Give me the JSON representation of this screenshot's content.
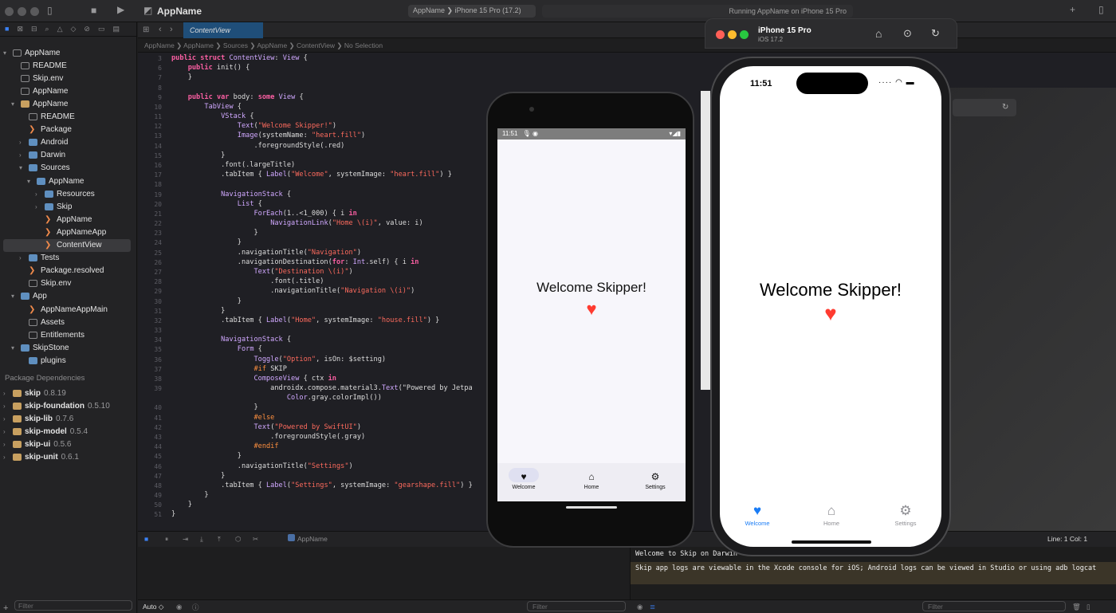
{
  "titlebar": {
    "app_name": "AppName",
    "scheme_target": "AppName  ❯  iPhone 15 Pro (17.2)",
    "status": "Running AppName on iPhone 15 Pro"
  },
  "editor": {
    "active_tab": "ContentView",
    "jumpbar": "AppName  ❯  AppName  ❯  Sources  ❯  AppName  ❯  ContentView  ❯  No Selection",
    "code_lines": [
      {
        "n": "3",
        "t": "public struct ContentView: View {"
      },
      {
        "n": "6",
        "t": "    public init() {"
      },
      {
        "n": "7",
        "t": "    }"
      },
      {
        "n": "8",
        "t": ""
      },
      {
        "n": "9",
        "t": "    public var body: some View {"
      },
      {
        "n": "10",
        "t": "        TabView {"
      },
      {
        "n": "11",
        "t": "            VStack {"
      },
      {
        "n": "12",
        "t": "                Text(\"Welcome Skipper!\")"
      },
      {
        "n": "13",
        "t": "                Image(systemName: \"heart.fill\")"
      },
      {
        "n": "14",
        "t": "                    .foregroundStyle(.red)"
      },
      {
        "n": "15",
        "t": "            }"
      },
      {
        "n": "16",
        "t": "            .font(.largeTitle)"
      },
      {
        "n": "17",
        "t": "            .tabItem { Label(\"Welcome\", systemImage: \"heart.fill\") }"
      },
      {
        "n": "18",
        "t": ""
      },
      {
        "n": "19",
        "t": "            NavigationStack {"
      },
      {
        "n": "20",
        "t": "                List {"
      },
      {
        "n": "21",
        "t": "                    ForEach(1..<1_000) { i in"
      },
      {
        "n": "22",
        "t": "                        NavigationLink(\"Home \\(i)\", value: i)"
      },
      {
        "n": "23",
        "t": "                    }"
      },
      {
        "n": "24",
        "t": "                }"
      },
      {
        "n": "25",
        "t": "                .navigationTitle(\"Navigation\")"
      },
      {
        "n": "26",
        "t": "                .navigationDestination(for: Int.self) { i in"
      },
      {
        "n": "27",
        "t": "                    Text(\"Destination \\(i)\")"
      },
      {
        "n": "28",
        "t": "                        .font(.title)"
      },
      {
        "n": "29",
        "t": "                        .navigationTitle(\"Navigation \\(i)\")"
      },
      {
        "n": "30",
        "t": "                }"
      },
      {
        "n": "31",
        "t": "            }"
      },
      {
        "n": "32",
        "t": "            .tabItem { Label(\"Home\", systemImage: \"house.fill\") }"
      },
      {
        "n": "33",
        "t": ""
      },
      {
        "n": "34",
        "t": "            NavigationStack {"
      },
      {
        "n": "35",
        "t": "                Form {"
      },
      {
        "n": "36",
        "t": "                    Toggle(\"Option\", isOn: $setting)"
      },
      {
        "n": "37",
        "t": "                    #if SKIP"
      },
      {
        "n": "38",
        "t": "                    ComposeView { ctx in"
      },
      {
        "n": "39",
        "t": "                        androidx.compose.material3.Text(\"Powered by Jetpa"
      },
      {
        "n": "",
        "t": "                            Color.gray.colorImpl())"
      },
      {
        "n": "40",
        "t": "                    }"
      },
      {
        "n": "41",
        "t": "                    #else"
      },
      {
        "n": "42",
        "t": "                    Text(\"Powered by SwiftUI\")"
      },
      {
        "n": "43",
        "t": "                        .foregroundStyle(.gray)"
      },
      {
        "n": "44",
        "t": "                    #endif"
      },
      {
        "n": "45",
        "t": "                }"
      },
      {
        "n": "46",
        "t": "                .navigationTitle(\"Settings\")"
      },
      {
        "n": "47",
        "t": "            }"
      },
      {
        "n": "48",
        "t": "            .tabItem { Label(\"Settings\", systemImage: \"gearshape.fill\") }"
      },
      {
        "n": "49",
        "t": "        }"
      },
      {
        "n": "50",
        "t": "    }"
      },
      {
        "n": "51",
        "t": "}"
      }
    ],
    "status_target": "AppName",
    "line_col": "Line: 1  Col: 1"
  },
  "navigator": {
    "items": [
      {
        "label": "AppName",
        "icon": "doc",
        "level": 0,
        "chev": "▾"
      },
      {
        "label": "README",
        "icon": "doc",
        "level": 1,
        "chev": ""
      },
      {
        "label": "Skip.env",
        "icon": "doc",
        "level": 1,
        "chev": ""
      },
      {
        "label": "AppName",
        "icon": "doc",
        "level": 1,
        "chev": ""
      },
      {
        "label": "AppName",
        "icon": "pkg",
        "level": 1,
        "chev": "▾"
      },
      {
        "label": "README",
        "icon": "doc",
        "level": 2,
        "chev": ""
      },
      {
        "label": "Package",
        "icon": "swift",
        "level": 2,
        "chev": ""
      },
      {
        "label": "Android",
        "icon": "folder",
        "level": 2,
        "chev": "›"
      },
      {
        "label": "Darwin",
        "icon": "folder",
        "level": 2,
        "chev": "›"
      },
      {
        "label": "Sources",
        "icon": "folder",
        "level": 2,
        "chev": "▾"
      },
      {
        "label": "AppName",
        "icon": "folder",
        "level": 3,
        "chev": "▾"
      },
      {
        "label": "Resources",
        "icon": "folder",
        "level": 4,
        "chev": "›"
      },
      {
        "label": "Skip",
        "icon": "folder",
        "level": 4,
        "chev": "›"
      },
      {
        "label": "AppName",
        "icon": "swift",
        "level": 4,
        "chev": ""
      },
      {
        "label": "AppNameApp",
        "icon": "swift",
        "level": 4,
        "chev": ""
      },
      {
        "label": "ContentView",
        "icon": "swift",
        "level": 4,
        "chev": "",
        "selected": true
      },
      {
        "label": "Tests",
        "icon": "folder",
        "level": 2,
        "chev": "›"
      },
      {
        "label": "Package.resolved",
        "icon": "swift",
        "level": 2,
        "chev": ""
      },
      {
        "label": "Skip.env",
        "icon": "doc",
        "level": 2,
        "chev": ""
      },
      {
        "label": "App",
        "icon": "folder",
        "level": 1,
        "chev": "▾"
      },
      {
        "label": "AppNameAppMain",
        "icon": "swift",
        "level": 2,
        "chev": ""
      },
      {
        "label": "Assets",
        "icon": "doc",
        "level": 2,
        "chev": ""
      },
      {
        "label": "Entitlements",
        "icon": "doc",
        "level": 2,
        "chev": ""
      },
      {
        "label": "SkipStone",
        "icon": "folder",
        "level": 1,
        "chev": "▾"
      },
      {
        "label": "plugins",
        "icon": "folder",
        "level": 2,
        "chev": ""
      }
    ],
    "package_dependencies_title": "Package Dependencies",
    "dependencies": [
      {
        "name": "skip",
        "version": "0.8.19"
      },
      {
        "name": "skip-foundation",
        "version": "0.5.10"
      },
      {
        "name": "skip-lib",
        "version": "0.7.6"
      },
      {
        "name": "skip-model",
        "version": "0.5.4"
      },
      {
        "name": "skip-ui",
        "version": "0.5.6"
      },
      {
        "name": "skip-unit",
        "version": "0.6.1"
      }
    ],
    "filter_placeholder": "Filter"
  },
  "ios_simulator": {
    "device": "iPhone 15 Pro",
    "os": "iOS 17.2",
    "time": "11:51",
    "welcome_text": "Welcome Skipper!",
    "tabs": [
      {
        "label": "Welcome",
        "icon": "heart-icon",
        "active": true
      },
      {
        "label": "Home",
        "icon": "house-icon",
        "active": false
      },
      {
        "label": "Settings",
        "icon": "gear-icon",
        "active": false
      }
    ],
    "accent_color": "#1a7cf5"
  },
  "android_emulator": {
    "time": "11:51",
    "welcome_text": "Welcome Skipper!",
    "tabs": [
      {
        "label": "Welcome",
        "icon": "heart-icon",
        "active": true
      },
      {
        "label": "Home",
        "icon": "house-icon",
        "active": false
      },
      {
        "label": "Settings",
        "icon": "gear-icon",
        "active": false
      }
    ]
  },
  "console": {
    "line1": "Welcome to Skip on Darwin",
    "line2": "Skip app logs are viewable in the Xcode console for iOS; Android logs can be viewed in Studio or using adb logcat",
    "filter_placeholder": "Filter"
  },
  "debug_bar": {
    "auto_label": "Auto ◇",
    "filter_placeholder": "Filter"
  }
}
